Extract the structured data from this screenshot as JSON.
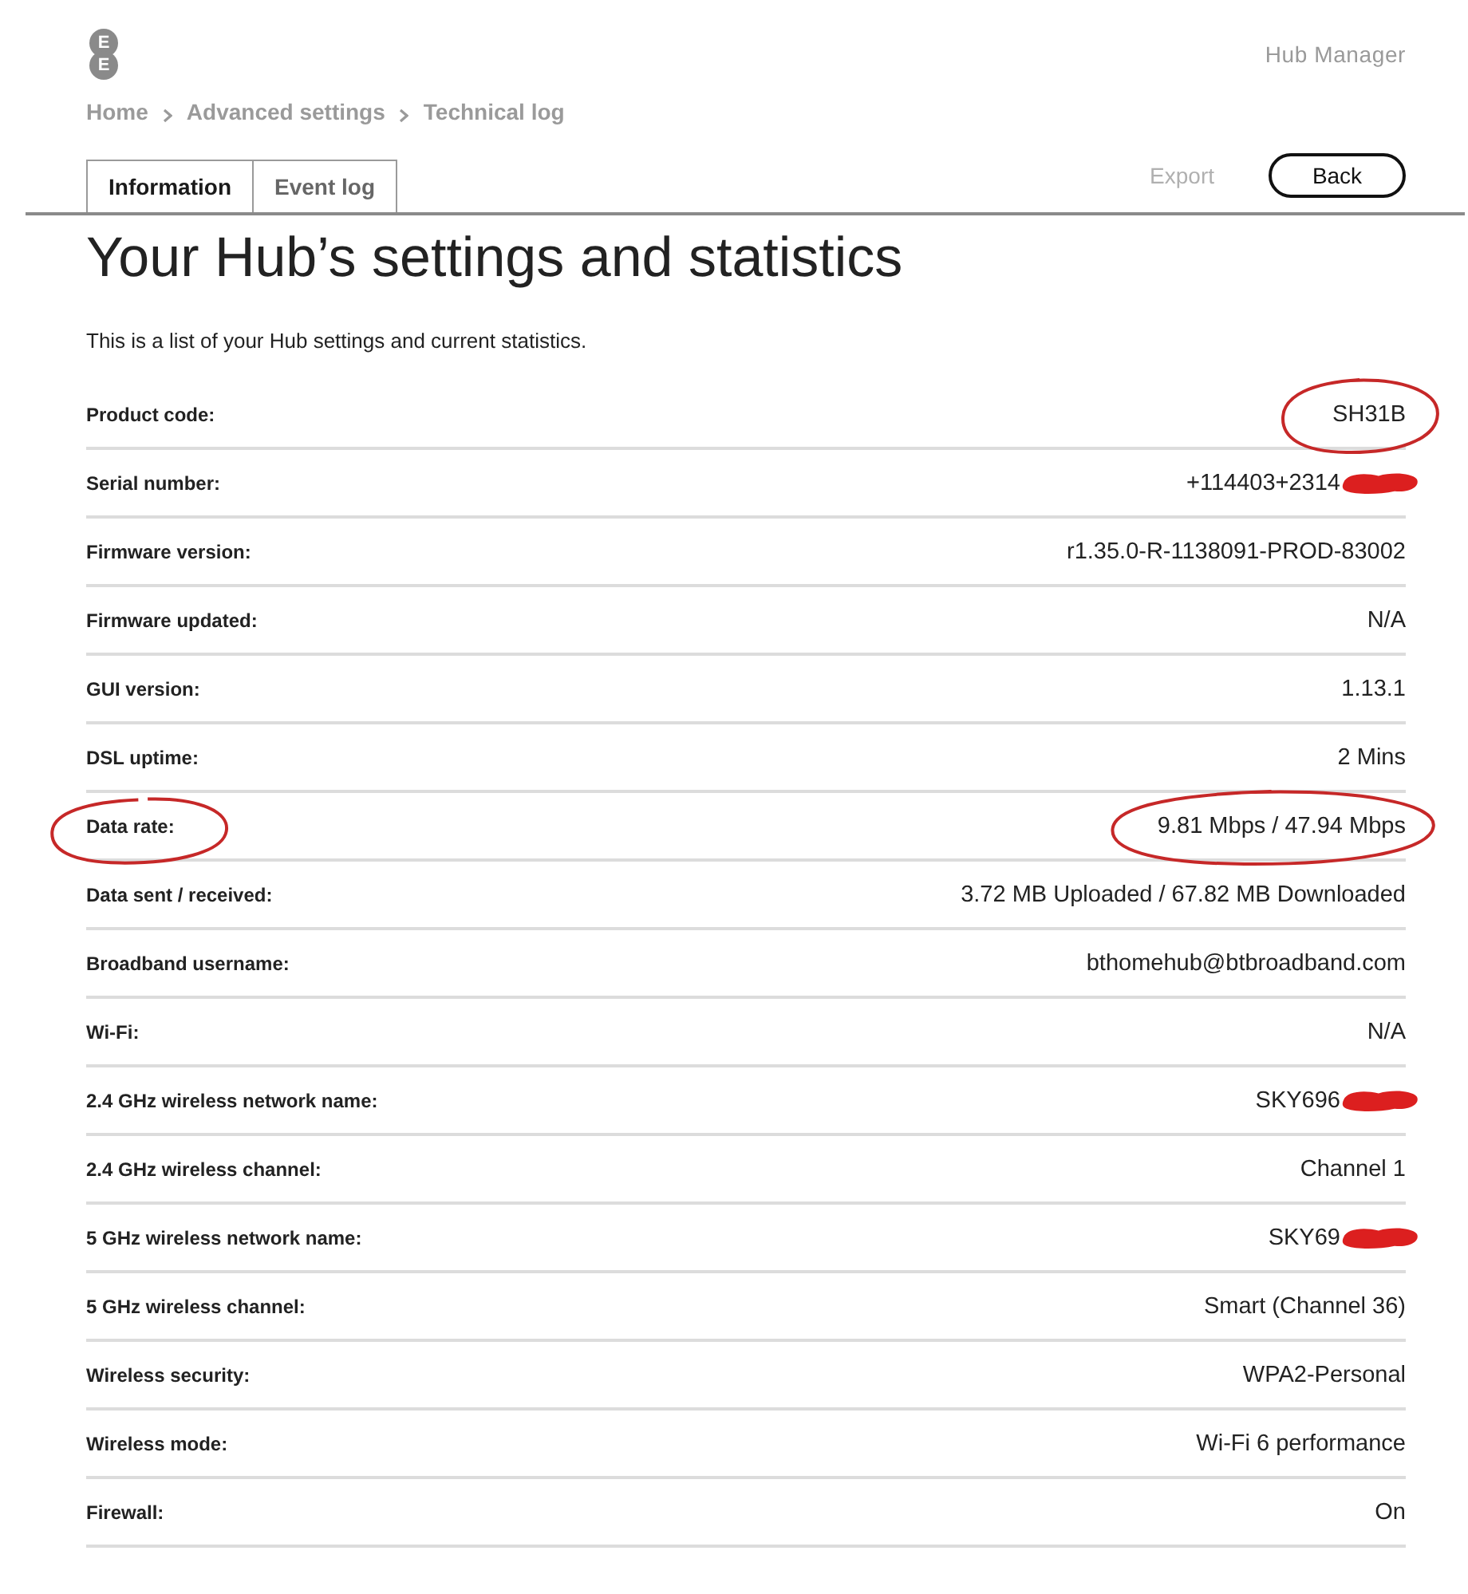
{
  "logo": {
    "letters": [
      "E",
      "E"
    ]
  },
  "app_name": "Hub Manager",
  "breadcrumb": [
    "Home",
    "Advanced settings",
    "Technical log"
  ],
  "tabs": [
    {
      "label": "Information",
      "selected": true
    },
    {
      "label": "Event log",
      "selected": false
    }
  ],
  "actions": [
    {
      "label": "Export",
      "kind": "link",
      "disabled": true
    },
    {
      "label": "Back",
      "kind": "button",
      "disabled": false
    }
  ],
  "title": "Your Hub’s settings and statistics",
  "description": "This is a list of your Hub settings and current statistics.",
  "rows": [
    {
      "label": "Product code:",
      "value": "SH31B",
      "label_circled": false,
      "value_circled": true,
      "value_scribbled": false
    },
    {
      "label": "Serial number:",
      "value": "+114403+2314",
      "label_circled": false,
      "value_circled": false,
      "value_scribbled": true
    },
    {
      "label": "Firmware version:",
      "value": "r1.35.0-R-1138091-PROD-83002",
      "label_circled": false,
      "value_circled": false,
      "value_scribbled": false
    },
    {
      "label": "Firmware updated:",
      "value": "N/A",
      "label_circled": false,
      "value_circled": false,
      "value_scribbled": false
    },
    {
      "label": "GUI version:",
      "value": "1.13.1",
      "label_circled": false,
      "value_circled": false,
      "value_scribbled": false
    },
    {
      "label": "DSL uptime:",
      "value": "2 Mins",
      "label_circled": false,
      "value_circled": false,
      "value_scribbled": false
    },
    {
      "label": "Data rate:",
      "value": "9.81 Mbps / 47.94 Mbps",
      "label_circled": true,
      "value_circled": true,
      "value_scribbled": false
    },
    {
      "label": "Data sent / received:",
      "value": "3.72 MB Uploaded / 67.82 MB Downloaded",
      "label_circled": false,
      "value_circled": false,
      "value_scribbled": false
    },
    {
      "label": "Broadband username:",
      "value": "bthomehub@btbroadband.com",
      "label_circled": false,
      "value_circled": false,
      "value_scribbled": false
    },
    {
      "label": "Wi-Fi:",
      "value": "N/A",
      "label_circled": false,
      "value_circled": false,
      "value_scribbled": false
    },
    {
      "label": "2.4 GHz wireless network name:",
      "value": "SKY696",
      "label_circled": false,
      "value_circled": false,
      "value_scribbled": true
    },
    {
      "label": "2.4 GHz wireless channel:",
      "value": "Channel 1",
      "label_circled": false,
      "value_circled": false,
      "value_scribbled": false
    },
    {
      "label": "5 GHz wireless network name:",
      "value": "SKY69",
      "label_circled": false,
      "value_circled": false,
      "value_scribbled": true
    },
    {
      "label": "5 GHz wireless channel:",
      "value": "Smart (Channel 36)",
      "label_circled": false,
      "value_circled": false,
      "value_scribbled": false
    },
    {
      "label": "Wireless security:",
      "value": "WPA2-Personal",
      "label_circled": false,
      "value_circled": false,
      "value_scribbled": false
    },
    {
      "label": "Wireless mode:",
      "value": "Wi-Fi 6 performance",
      "label_circled": false,
      "value_circled": false,
      "value_scribbled": false
    },
    {
      "label": "Firewall:",
      "value": "On",
      "label_circled": false,
      "value_circled": false,
      "value_scribbled": false
    }
  ]
}
